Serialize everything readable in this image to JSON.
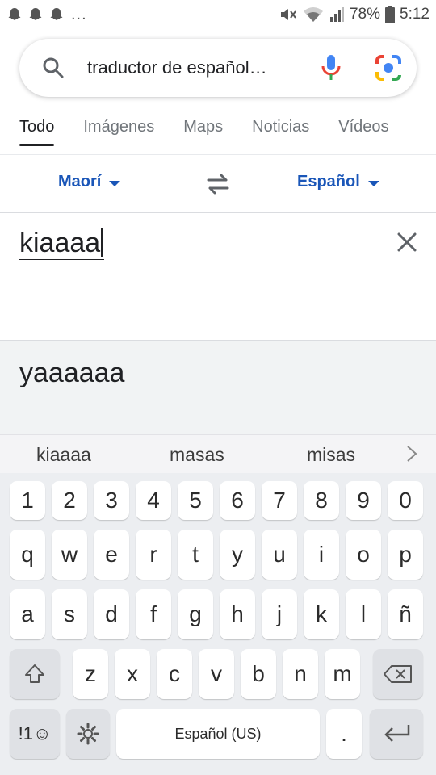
{
  "status_bar": {
    "notification_icons": [
      "snapchat-icon",
      "snapchat-icon",
      "snapchat-icon"
    ],
    "more": "...",
    "battery": "78%",
    "time": "5:12"
  },
  "search": {
    "query": "traductor de español…",
    "icons": [
      "search-icon",
      "mic-icon",
      "google-lens-icon"
    ]
  },
  "tabs": [
    {
      "label": "Todo",
      "active": true
    },
    {
      "label": "Imágenes",
      "active": false
    },
    {
      "label": "Maps",
      "active": false
    },
    {
      "label": "Noticias",
      "active": false
    },
    {
      "label": "Vídeos",
      "active": false
    }
  ],
  "translator": {
    "source_lang": "Maorí",
    "target_lang": "Español",
    "input_text": "kiaaaa",
    "output_text": "yaaaaaa",
    "accent_color": "#1a56b8"
  },
  "keyboard": {
    "suggestions": [
      "kiaaaa",
      "masas",
      "misas"
    ],
    "number_row": [
      "1",
      "2",
      "3",
      "4",
      "5",
      "6",
      "7",
      "8",
      "9",
      "0"
    ],
    "row1": [
      "q",
      "w",
      "e",
      "r",
      "t",
      "y",
      "u",
      "i",
      "o",
      "p"
    ],
    "row2": [
      "a",
      "s",
      "d",
      "f",
      "g",
      "h",
      "j",
      "k",
      "l",
      "ñ"
    ],
    "row3": [
      "z",
      "x",
      "c",
      "v",
      "b",
      "n",
      "m"
    ],
    "symbols_label": "!1☺",
    "space_label": "Español (US)",
    "period_label": "."
  }
}
